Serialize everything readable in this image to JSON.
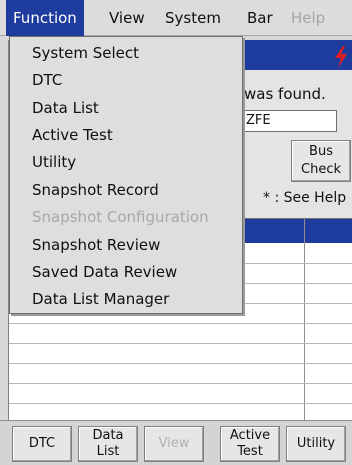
{
  "menubar": {
    "items": [
      {
        "label": "Function",
        "state": "active"
      },
      {
        "label": "View",
        "state": "normal"
      },
      {
        "label": "System",
        "state": "normal"
      },
      {
        "label": "Bar",
        "state": "normal"
      },
      {
        "label": "Help",
        "state": "disabled"
      }
    ]
  },
  "dropdown": {
    "items": [
      {
        "label": "System Select",
        "enabled": true
      },
      {
        "label": "DTC",
        "enabled": true
      },
      {
        "label": "Data List",
        "enabled": true
      },
      {
        "label": "Active Test",
        "enabled": true
      },
      {
        "label": "Utility",
        "enabled": true
      },
      {
        "label": "Snapshot Record",
        "enabled": true
      },
      {
        "label": "Snapshot Configuration",
        "enabled": false
      },
      {
        "label": "Snapshot Review",
        "enabled": true
      },
      {
        "label": "Saved Data Review",
        "enabled": true
      },
      {
        "label": "Data List Manager",
        "enabled": true
      }
    ]
  },
  "window": {
    "message": "was found.",
    "code_value": "ZFE",
    "bus_check_label_1": "Bus",
    "bus_check_label_2": "Check",
    "see_help": "* : See Help"
  },
  "toolbar": {
    "dtc": "DTC",
    "data_list_1": "Data",
    "data_list_2": "List",
    "view": "View",
    "active_test_1": "Active",
    "active_test_2": "Test",
    "utility": "Utility"
  },
  "colors": {
    "accent": "#1e3b9e",
    "bolt": "#e02020"
  }
}
